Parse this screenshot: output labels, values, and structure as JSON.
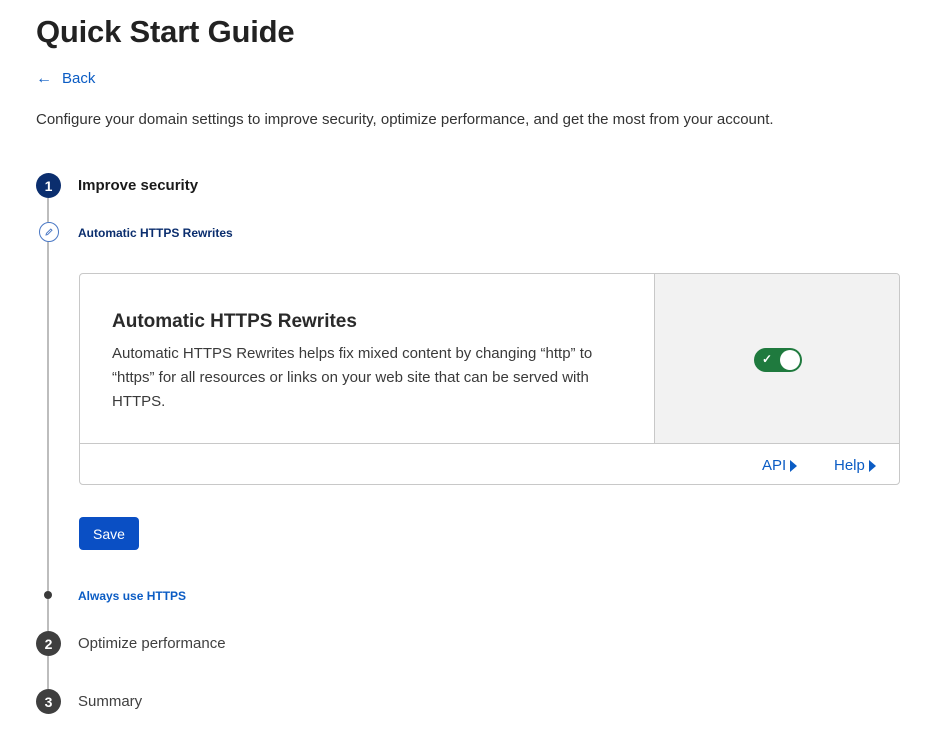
{
  "page": {
    "title": "Quick Start Guide",
    "back_label": "Back",
    "intro": "Configure your domain settings to improve security, optimize performance, and get the most from your account."
  },
  "steps": [
    {
      "number": "1",
      "label": "Improve security",
      "state": "active"
    },
    {
      "number": "2",
      "label": "Optimize performance",
      "state": "pending"
    },
    {
      "number": "3",
      "label": "Summary",
      "state": "pending"
    }
  ],
  "substeps": [
    {
      "label": "Automatic HTTPS Rewrites",
      "state": "current"
    },
    {
      "label": "Always use HTTPS",
      "state": "upcoming"
    }
  ],
  "card": {
    "title": "Automatic HTTPS Rewrites",
    "description": "Automatic HTTPS Rewrites helps fix mixed content by changing “http” to “https” for all resources or links on your web site that can be served with HTTPS.",
    "toggle_on": true,
    "toggle_check": "✓",
    "api_label": "API",
    "help_label": "Help"
  },
  "actions": {
    "save_label": "Save"
  },
  "colors": {
    "primary": "#0a4fc4",
    "step_active": "#0b2e6e",
    "toggle_on": "#1f7a3e"
  },
  "icons": {
    "back": "arrow-left-icon",
    "substep": "pencil-icon",
    "link_caret": "caret-right-icon"
  }
}
